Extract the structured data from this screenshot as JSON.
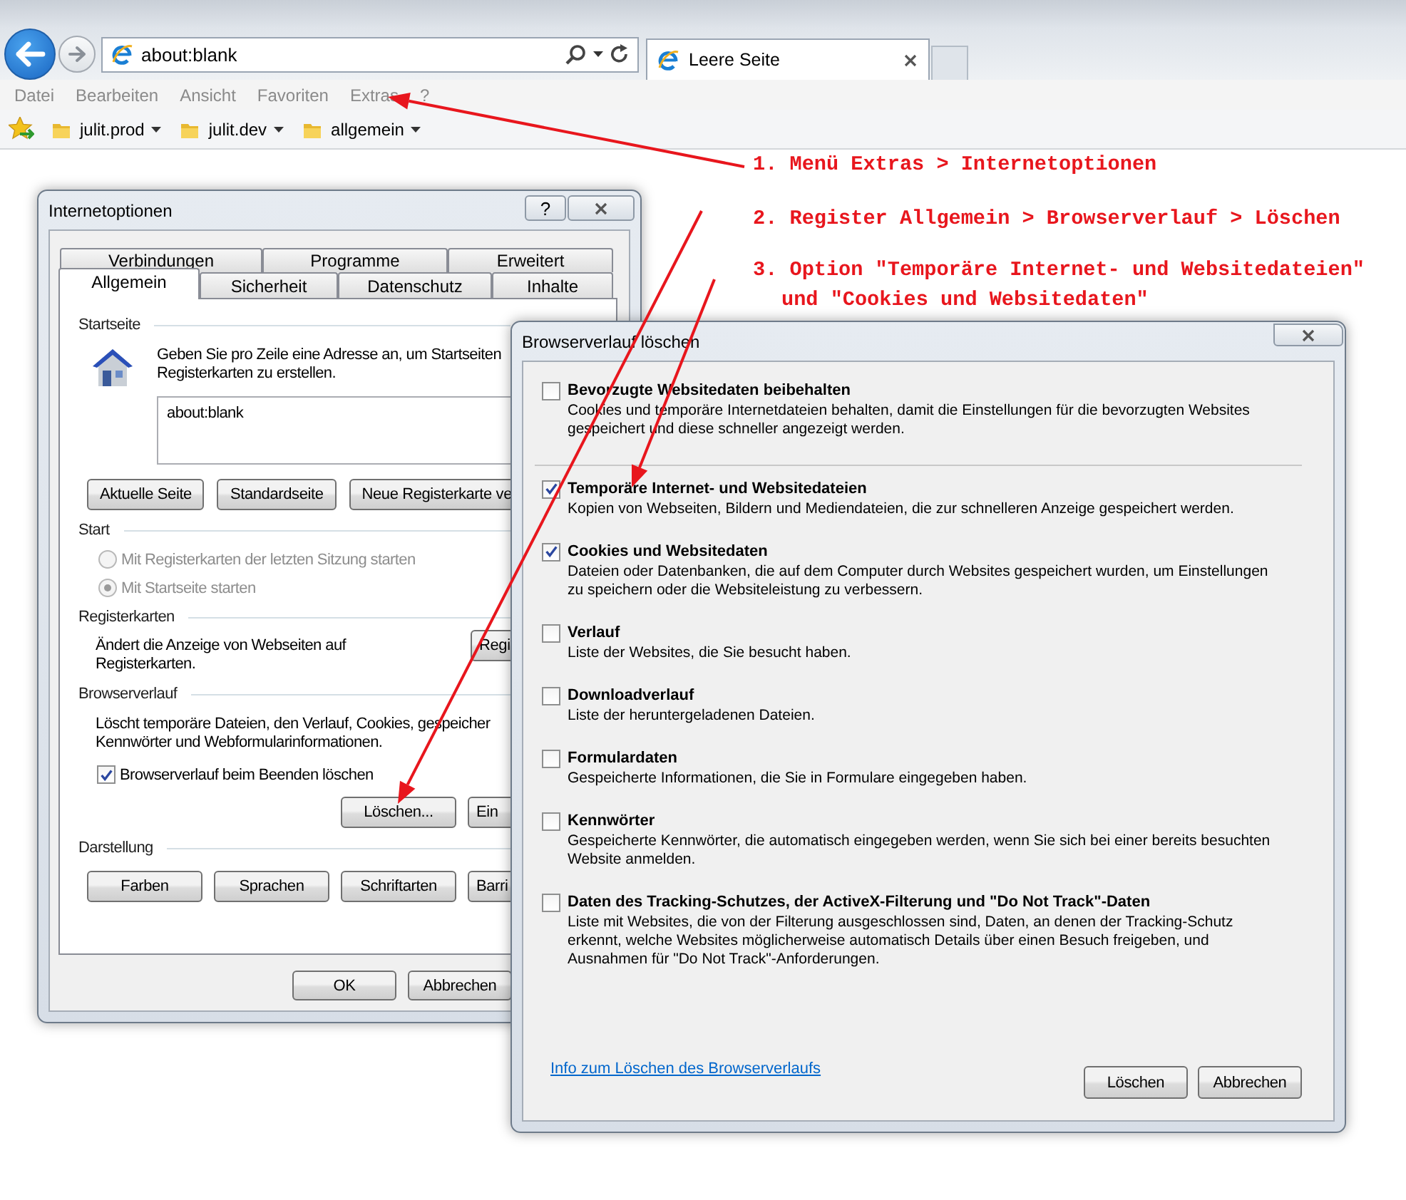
{
  "browser": {
    "address": "about:blank",
    "tab": {
      "title": "Leere Seite",
      "selected": true
    },
    "menu": [
      {
        "label": "Datei"
      },
      {
        "label": "Bearbeiten"
      },
      {
        "label": "Ansicht"
      },
      {
        "label": "Favoriten"
      },
      {
        "label": "Extras"
      },
      {
        "label": "?"
      }
    ],
    "favorites": [
      {
        "label": "julit.prod"
      },
      {
        "label": "julit.dev"
      },
      {
        "label": "allgemein"
      }
    ]
  },
  "annotations": [
    {
      "lines": [
        "1. Menü Extras > Internetoptionen"
      ]
    },
    {
      "lines": [
        "2. Register Allgemein > Browserverlauf > Löschen"
      ]
    },
    {
      "lines": [
        "3. Option \"Temporäre Internet- und Websitedateien\"",
        "und \"Cookies und Websitedaten\""
      ]
    }
  ],
  "internet_options": {
    "title": "Internetoptionen",
    "help": "?",
    "tabs_back": [
      {
        "label": "Verbindungen",
        "selected": false
      },
      {
        "label": "Programme",
        "selected": false
      },
      {
        "label": "Erweitert",
        "selected": false
      }
    ],
    "tabs_front": [
      {
        "label": "Allgemein",
        "selected": true
      },
      {
        "label": "Sicherheit",
        "selected": false
      },
      {
        "label": "Datenschutz",
        "selected": false
      },
      {
        "label": "Inhalte",
        "selected": false
      }
    ],
    "sections": [
      {
        "heading": "Startseite",
        "items": [
          {
            "kind": "icon_note",
            "lines": [
              "Geben Sie pro Zeile eine Adresse an, um Startseiten",
              "Registerkarten zu erstellen."
            ]
          },
          {
            "kind": "textarea",
            "value": "about:blank"
          },
          {
            "kind": "buttons",
            "labels": [
              "Aktuelle Seite",
              "Standardseite",
              "Neue Registerkarte ve"
            ]
          }
        ]
      },
      {
        "heading": "Start",
        "items": [
          {
            "kind": "radio",
            "label": "Mit Registerkarten der letzten Sitzung starten",
            "selected": false,
            "disabled": true
          },
          {
            "kind": "radio",
            "label": "Mit Startseite starten",
            "selected": true,
            "disabled": true
          }
        ]
      },
      {
        "heading": "Registerkarten",
        "items": [
          {
            "kind": "note",
            "lines": [
              "Ändert die Anzeige von Webseiten auf",
              "Registerkarten."
            ],
            "button": "Regi"
          }
        ]
      },
      {
        "heading": "Browserverlauf",
        "items": [
          {
            "kind": "note",
            "lines": [
              "Löscht temporäre Dateien, den Verlauf, Cookies, gespeicher",
              "Kennwörter und Webformularinformationen."
            ]
          },
          {
            "kind": "checkbox",
            "label": "Browserverlauf beim Beenden löschen",
            "checked": true
          },
          {
            "kind": "grid_buttons",
            "labels": [
              "Löschen...",
              "Ein"
            ]
          }
        ]
      },
      {
        "heading": "Darstellung",
        "items": [
          {
            "kind": "grid_buttons",
            "labels": [
              "Farben",
              "Sprachen",
              "Schriftarten",
              "Barri"
            ]
          }
        ]
      }
    ],
    "buttons": [
      "OK",
      "Abbrechen"
    ]
  },
  "clear_history": {
    "title": "Browserverlauf löschen",
    "options": [
      {
        "kind": "preserve",
        "label": "Bevorzugte Websitedaten beibehalten",
        "description": [
          "Cookies und temporäre Internetdateien behalten, damit die Einstellungen für die bevorzugten Websites",
          "gespeichert und diese schneller angezeigt werden."
        ],
        "checked": false
      },
      {
        "kind": "clear",
        "label": "Temporäre Internet- und Websitedateien",
        "description": [
          "Kopien von Webseiten, Bildern und Mediendateien, die zur schnelleren Anzeige gespeichert werden."
        ],
        "checked": true
      },
      {
        "kind": "clear",
        "label": "Cookies und Websitedaten",
        "description": [
          "Dateien oder Datenbanken, die auf dem Computer durch Websites gespeichert wurden, um Einstellungen",
          "zu speichern oder die Websiteleistung zu verbessern."
        ],
        "checked": true
      },
      {
        "kind": "clear",
        "label": "Verlauf",
        "description": [
          "Liste der Websites, die Sie besucht haben."
        ],
        "checked": false
      },
      {
        "kind": "clear",
        "label": "Downloadverlauf",
        "description": [
          "Liste der heruntergeladenen Dateien."
        ],
        "checked": false
      },
      {
        "kind": "clear",
        "label": "Formulardaten",
        "description": [
          "Gespeicherte Informationen, die Sie in Formulare eingegeben haben."
        ],
        "checked": false
      },
      {
        "kind": "clear",
        "label": "Kennwörter",
        "description": [
          "Gespeicherte Kennwörter, die automatisch eingegeben werden, wenn Sie sich bei einer bereits besuchten",
          "Website anmelden."
        ],
        "checked": false
      },
      {
        "kind": "clear",
        "label": "Daten des Tracking-Schutzes, der ActiveX-Filterung und \"Do Not Track\"-Daten",
        "description": [
          "Liste mit Websites, die von der Filterung ausgeschlossen sind, Daten, an denen der Tracking-Schutz",
          "erkennt, welche Websites möglicherweise automatisch Details über einen Besuch freigeben, und",
          "Ausnahmen für \"Do Not Track\"-Anforderungen."
        ],
        "checked": false
      }
    ],
    "link": "Info zum Löschen des Browserverlaufs",
    "buttons": [
      "Löschen",
      "Abbrechen"
    ]
  }
}
